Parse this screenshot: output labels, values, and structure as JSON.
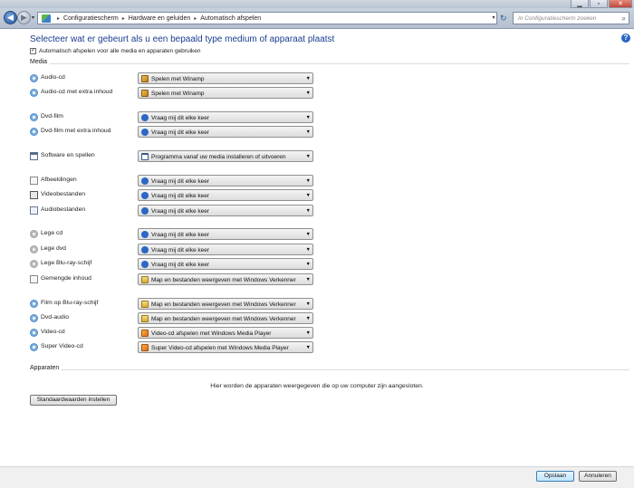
{
  "window": {
    "min_glyph": "▁",
    "max_glyph": "▫",
    "close_glyph": "✕"
  },
  "address": {
    "breadcrumbs": [
      "Configuratiescherm",
      "Hardware en geluiden",
      "Automatisch afspelen"
    ],
    "search_placeholder": "In Configuratiescherm zoeken"
  },
  "heading": "Selecteer wat er gebeurt als u een bepaald type medium of apparaat plaatst",
  "autoplay_checkbox": {
    "label": "Automatisch afspelen voor alle media en apparaten gebruiken",
    "checked": true,
    "glyph": "✓"
  },
  "media": {
    "section_title": "Media",
    "rows": [
      {
        "label": "Audio-cd",
        "icon": "cd-icon",
        "value": "Spelen met Winamp",
        "value_icon": "winamp-icon"
      },
      {
        "label": "Audio-cd met extra inhoud",
        "icon": "cd-icon",
        "value": "Spelen met Winamp",
        "value_icon": "winamp-icon"
      },
      {
        "label": "Dvd-film",
        "icon": "cd-icon",
        "value": "Vraag mij dit elke keer",
        "value_icon": "question-icon"
      },
      {
        "label": "Dvd-film met extra inhoud",
        "icon": "cd-icon",
        "value": "Vraag mij dit elke keer",
        "value_icon": "question-icon"
      },
      {
        "label": "Software en spellen",
        "icon": "software-icon",
        "value": "Programma vanaf uw media installeren of uitvoeren",
        "value_icon": "install-icon"
      },
      {
        "label": "Afbeeldingen",
        "icon": "file-icon",
        "value": "Vraag mij dit elke keer",
        "value_icon": "question-icon"
      },
      {
        "label": "Videobestanden",
        "icon": "video-file-icon",
        "value": "Vraag mij dit elke keer",
        "value_icon": "question-icon"
      },
      {
        "label": "Audiobestanden",
        "icon": "audio-file-icon",
        "value": "Vraag mij dit elke keer",
        "value_icon": "question-icon"
      },
      {
        "label": "Lege cd",
        "icon": "disc-icon",
        "value": "Vraag mij dit elke keer",
        "value_icon": "question-icon"
      },
      {
        "label": "Lege dvd",
        "icon": "disc-icon",
        "value": "Vraag mij dit elke keer",
        "value_icon": "question-icon"
      },
      {
        "label": "Lege Blu-ray-schijf",
        "icon": "disc-icon",
        "value": "Vraag mij dit elke keer",
        "value_icon": "question-icon"
      },
      {
        "label": "Gemengde inhoud",
        "icon": "file-icon",
        "value": "Map en bestanden weergeven met Windows Verkenner",
        "value_icon": "folder-icon"
      },
      {
        "label": "Film op Blu-ray-schijf",
        "icon": "cd-icon",
        "value": "Map en bestanden weergeven met Windows Verkenner",
        "value_icon": "folder-icon"
      },
      {
        "label": "Dvd-audio",
        "icon": "cd-icon",
        "value": "Map en bestanden weergeven met Windows Verkenner",
        "value_icon": "folder-icon"
      },
      {
        "label": "Video-cd",
        "icon": "cd-icon",
        "value": "Video-cd afspelen met Windows Media Player",
        "value_icon": "wmp-icon"
      },
      {
        "label": "Super Video-cd",
        "icon": "cd-icon",
        "value": "Super Video-cd afspelen met Windows Media Player",
        "value_icon": "wmp-icon"
      }
    ]
  },
  "devices": {
    "section_title": "Apparaten",
    "message": "Hier worden de apparaten weergegeven die op uw computer zijn aangesloten."
  },
  "buttons": {
    "reset": "Standaardwaarden instellen",
    "save": "Opslaan",
    "cancel": "Annuleren"
  }
}
